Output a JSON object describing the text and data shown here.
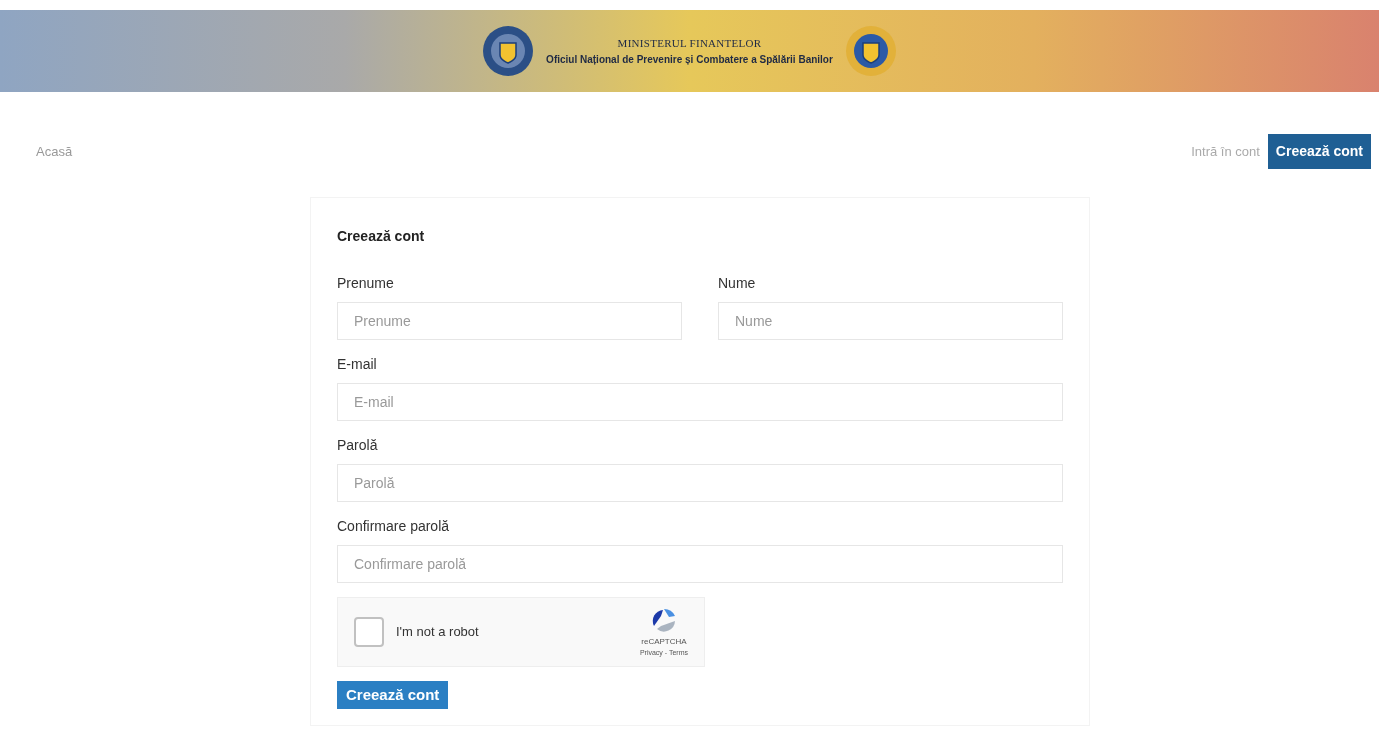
{
  "header": {
    "ministry": "MINISTERUL FINANTELOR",
    "office": "Oficiul Național de Prevenire și Combatere a Spălării Banilor"
  },
  "nav": {
    "home": "Acasă",
    "login": "Intră în cont",
    "register": "Creează cont"
  },
  "form": {
    "title": "Creează cont",
    "name_fields": [
      {
        "label": "Prenume",
        "placeholder": "Prenume"
      },
      {
        "label": "Nume",
        "placeholder": "Nume"
      }
    ],
    "fields": [
      {
        "label": "E-mail",
        "placeholder": "E-mail"
      },
      {
        "label": "Parolă",
        "placeholder": "Parolă"
      },
      {
        "label": "Confirmare parolă",
        "placeholder": "Confirmare parolă"
      }
    ],
    "captcha": {
      "label": "I'm not a robot",
      "checked": false,
      "brand": "reCAPTCHA",
      "links": "Privacy - Terms"
    },
    "submit": "Creează cont"
  }
}
